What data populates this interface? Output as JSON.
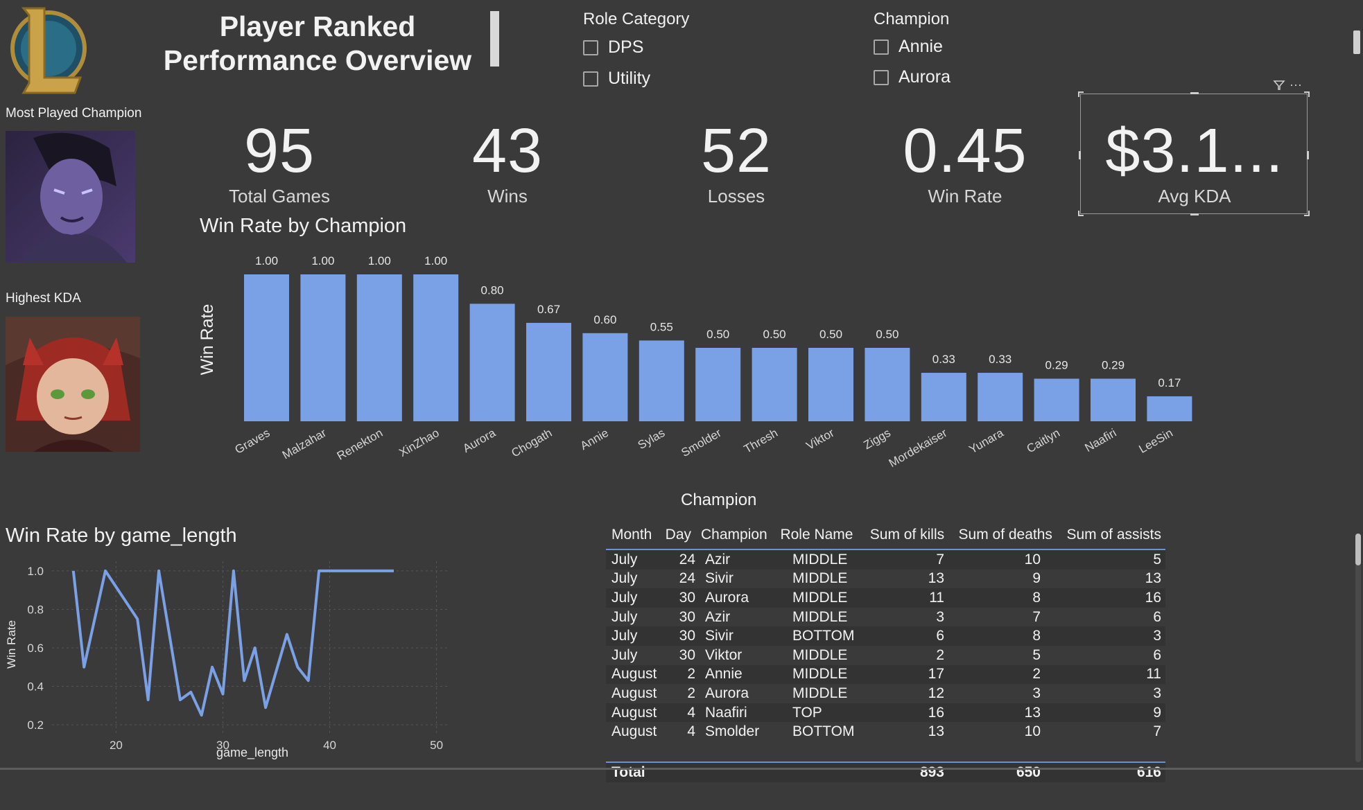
{
  "header": {
    "title_line1": "Player Ranked",
    "title_line2": "Performance Overview"
  },
  "slicers": {
    "role": {
      "heading": "Role Category",
      "options": [
        "DPS",
        "Utility"
      ]
    },
    "champion": {
      "heading": "Champion",
      "options": [
        "Annie",
        "Aurora"
      ]
    }
  },
  "side": {
    "most_played_label": "Most Played Champion",
    "highest_kda_label": "Highest KDA"
  },
  "kpis": [
    {
      "value": "95",
      "label": "Total Games"
    },
    {
      "value": "43",
      "label": "Wins"
    },
    {
      "value": "52",
      "label": "Losses"
    },
    {
      "value": "0.45",
      "label": "Win Rate"
    },
    {
      "value": "$3.1...",
      "label": "Avg KDA"
    }
  ],
  "card_icons": [
    "filter-icon",
    "more-options-icon"
  ],
  "colors": {
    "accent": "#7aa0e6",
    "background": "#3a3a3a"
  },
  "chart_data": [
    {
      "type": "bar",
      "title": "Win Rate by Champion",
      "xlabel": "Champion",
      "ylabel": "Win Rate",
      "categories": [
        "Graves",
        "Malzahar",
        "Renekton",
        "XinZhao",
        "Aurora",
        "Chogath",
        "Annie",
        "Sylas",
        "Smolder",
        "Thresh",
        "Viktor",
        "Ziggs",
        "Mordekaiser",
        "Yunara",
        "Caitlyn",
        "Naafiri",
        "LeeSin"
      ],
      "values": [
        1.0,
        1.0,
        1.0,
        1.0,
        0.8,
        0.67,
        0.6,
        0.55,
        0.5,
        0.5,
        0.5,
        0.5,
        0.33,
        0.33,
        0.29,
        0.29,
        0.17
      ],
      "data_labels": [
        "1.00",
        "1.00",
        "1.00",
        "1.00",
        "0.80",
        "0.67",
        "0.60",
        "0.55",
        "0.50",
        "0.50",
        "0.50",
        "0.50",
        "0.33",
        "0.33",
        "0.29",
        "0.29",
        "0.17"
      ],
      "ylim": [
        0,
        1
      ]
    },
    {
      "type": "line",
      "title": "Win Rate by game_length",
      "xlabel": "game_length",
      "ylabel": "Win Rate",
      "x": [
        16,
        17,
        19,
        22,
        23,
        24,
        26,
        27,
        28,
        29,
        30,
        31,
        32,
        33,
        34,
        36,
        37,
        38,
        39,
        40,
        46
      ],
      "y": [
        1.0,
        0.5,
        1.0,
        0.75,
        0.33,
        1.0,
        0.33,
        0.37,
        0.25,
        0.5,
        0.36,
        1.0,
        0.43,
        0.6,
        0.29,
        0.67,
        0.5,
        0.43,
        1.0,
        1.0,
        1.0
      ],
      "xticks": [
        "20",
        "30",
        "40",
        "50"
      ],
      "yticks": [
        "1.0",
        "0.8",
        "0.6",
        "0.4",
        "0.2"
      ],
      "xlim": [
        14,
        51
      ],
      "ylim": [
        0.15,
        1.05
      ]
    }
  ],
  "table": {
    "columns": [
      "Month",
      "Day",
      "Champion",
      "Role Name",
      "Sum of kills",
      "Sum of deaths",
      "Sum of assists"
    ],
    "rows": [
      [
        "July",
        "24",
        "Azir",
        "MIDDLE",
        "7",
        "10",
        "5"
      ],
      [
        "July",
        "24",
        "Sivir",
        "MIDDLE",
        "13",
        "9",
        "13"
      ],
      [
        "July",
        "30",
        "Aurora",
        "MIDDLE",
        "11",
        "8",
        "16"
      ],
      [
        "July",
        "30",
        "Azir",
        "MIDDLE",
        "3",
        "7",
        "6"
      ],
      [
        "July",
        "30",
        "Sivir",
        "BOTTOM",
        "6",
        "8",
        "3"
      ],
      [
        "July",
        "30",
        "Viktor",
        "MIDDLE",
        "2",
        "5",
        "6"
      ],
      [
        "August",
        "2",
        "Annie",
        "MIDDLE",
        "17",
        "2",
        "11"
      ],
      [
        "August",
        "2",
        "Aurora",
        "MIDDLE",
        "12",
        "3",
        "3"
      ],
      [
        "August",
        "4",
        "Naafiri",
        "TOP",
        "16",
        "13",
        "9"
      ],
      [
        "August",
        "4",
        "Smolder",
        "BOTTOM",
        "13",
        "10",
        "7"
      ]
    ],
    "total": [
      "Total",
      "",
      "",
      "",
      "893",
      "650",
      "616"
    ]
  }
}
